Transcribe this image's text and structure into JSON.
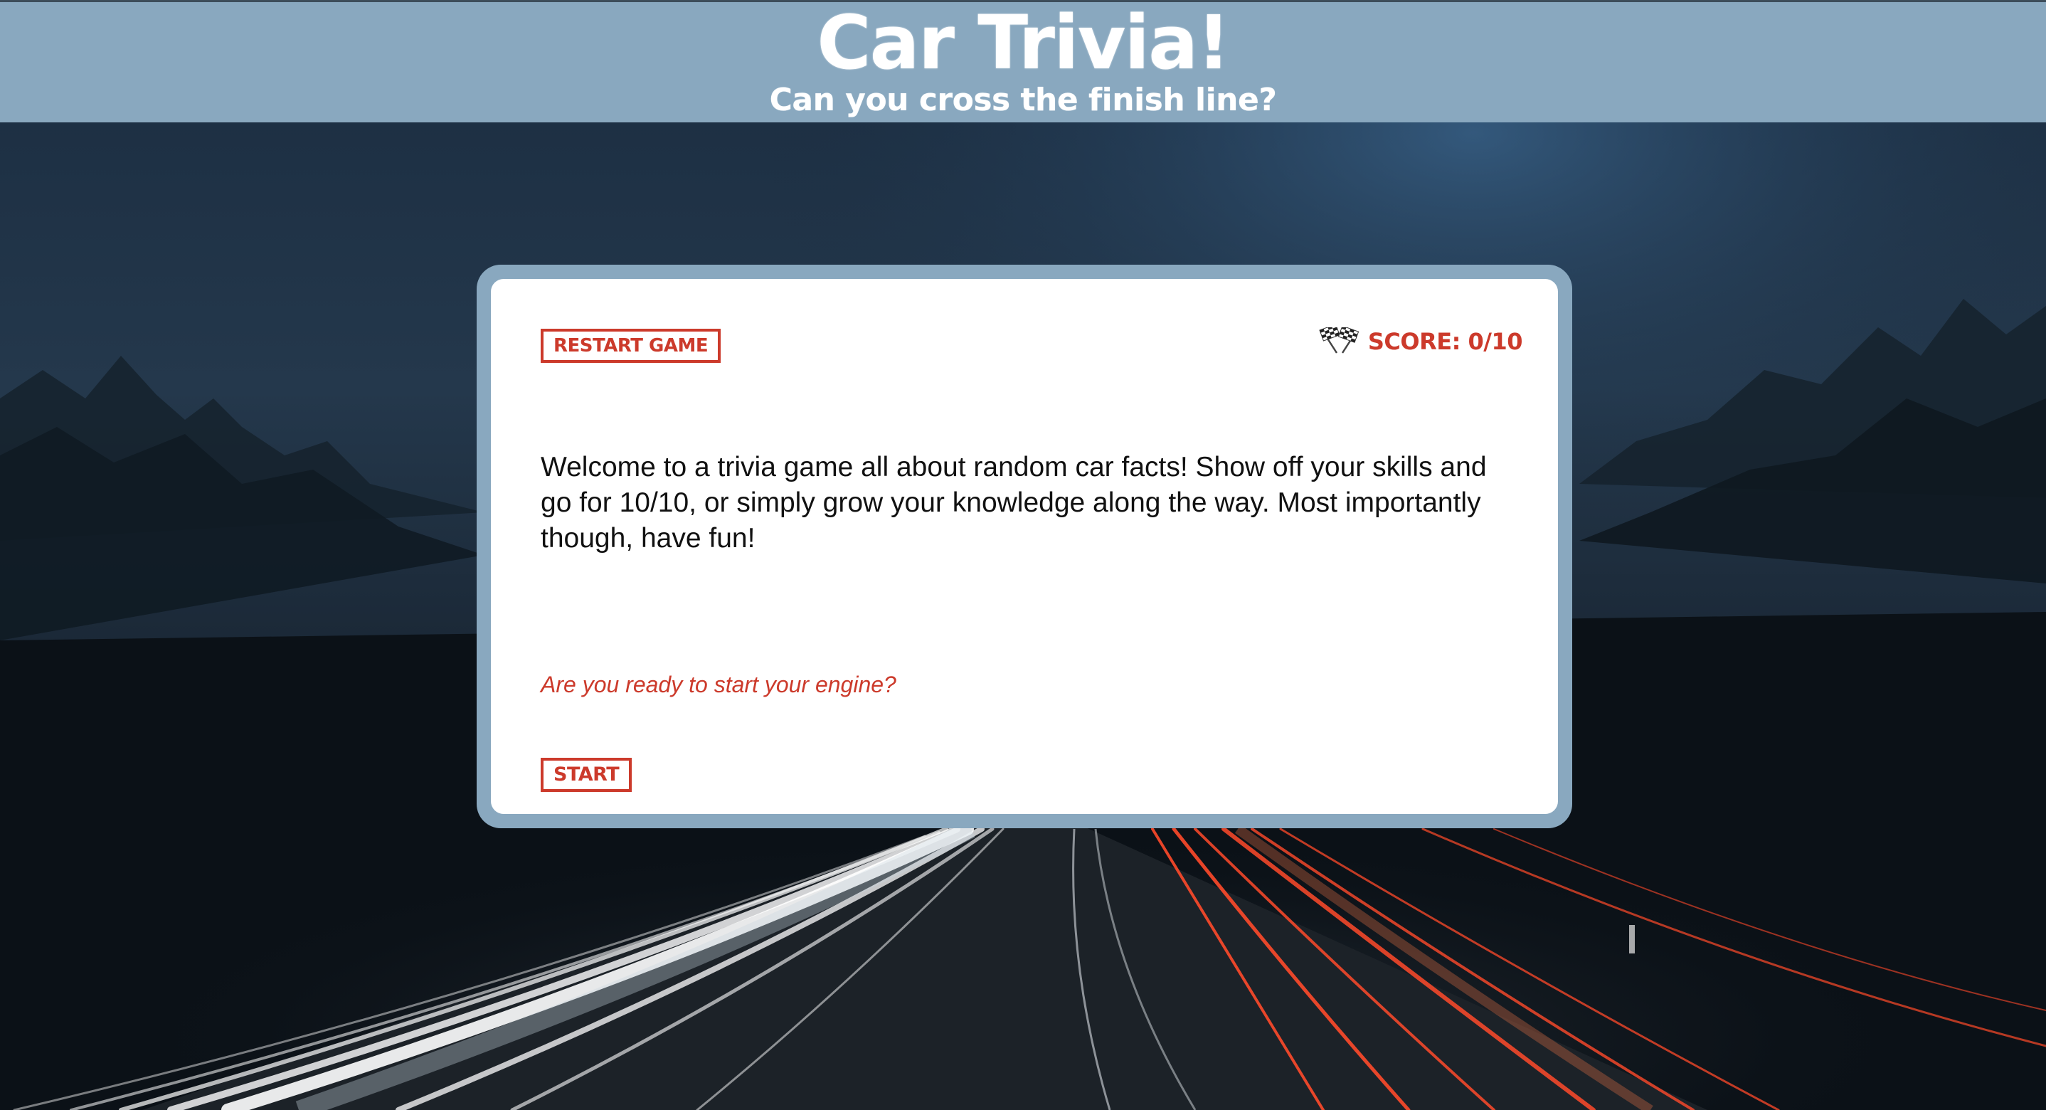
{
  "header": {
    "title": "Car Trivia!",
    "subtitle": "Can you cross the finish line?"
  },
  "card": {
    "restart_label": "RESTART GAME",
    "score_label": "SCORE: 0/10",
    "score_icon": "checkered-flags-icon",
    "welcome_text": "Welcome to a trivia game all about random car facts! Show off your skills and go for 10/10, or simply grow your knowledge along the way. Most importantly though, have fun!",
    "prompt_text": "Are you ready to start your engine?",
    "start_label": "START"
  },
  "colors": {
    "header_bg": "#89a8bf",
    "accent": "#cc3a2b",
    "card_bg": "#ffffff"
  }
}
